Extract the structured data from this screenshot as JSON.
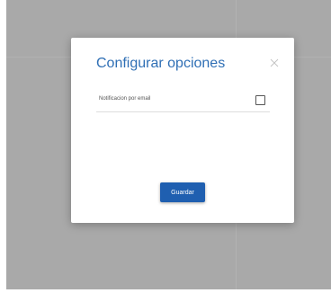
{
  "colors": {
    "backdrop": "#a9a9a9",
    "accent": "#2f6fb5",
    "button": "#1f5fb0"
  },
  "modal": {
    "title": "Configurar opciones",
    "close_icon": "close-icon",
    "option": {
      "label": "Notificacion por email",
      "checked": false
    },
    "save_label": "Guardar"
  }
}
